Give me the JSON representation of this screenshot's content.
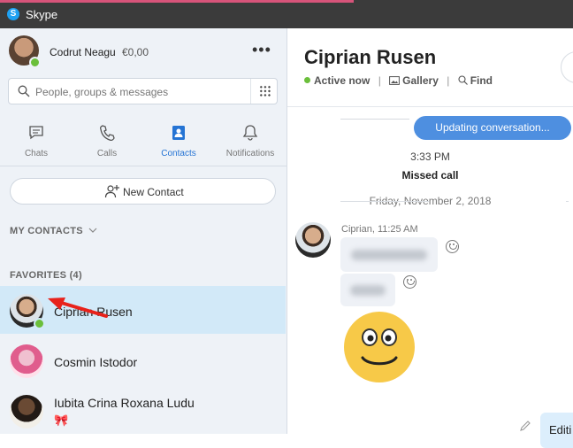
{
  "window": {
    "app_title": "Skype"
  },
  "profile": {
    "name": "Codrut Neagu",
    "credit": "€0,00",
    "more_label": "•••"
  },
  "search": {
    "placeholder": "People, groups & messages"
  },
  "nav": [
    {
      "label": "Chats",
      "icon": "chat-icon"
    },
    {
      "label": "Calls",
      "icon": "phone-icon"
    },
    {
      "label": "Contacts",
      "icon": "contacts-icon",
      "active": true
    },
    {
      "label": "Notifications",
      "icon": "bell-icon"
    }
  ],
  "new_contact": {
    "label": "New Contact"
  },
  "sections": {
    "my_contacts": "MY CONTACTS",
    "favorites": "FAVORITES (4)"
  },
  "contacts": [
    {
      "name": "Ciprian Rusen",
      "online": true,
      "selected": true
    },
    {
      "name": "Cosmin Istodor",
      "online": false
    },
    {
      "name": "Iubita Crina Roxana Ludu",
      "online": false,
      "badge": "🎀"
    }
  ],
  "conversation": {
    "title": "Ciprian Rusen",
    "status": "Active now",
    "gallery_label": "Gallery",
    "find_label": "Find",
    "separator": "|",
    "updating_label": "Updating conversation...",
    "call_time": "3:33 PM",
    "call_status": "Missed call",
    "date_separator": "Friday, November 2, 2018",
    "sender_line": "Ciprian, 11:25 AM",
    "editing_text": "Editi"
  },
  "colors": {
    "accent": "#2574d4",
    "online": "#6bbf3b",
    "selected_row": "#d2e9f8",
    "button_blue": "#4e8fe0"
  }
}
